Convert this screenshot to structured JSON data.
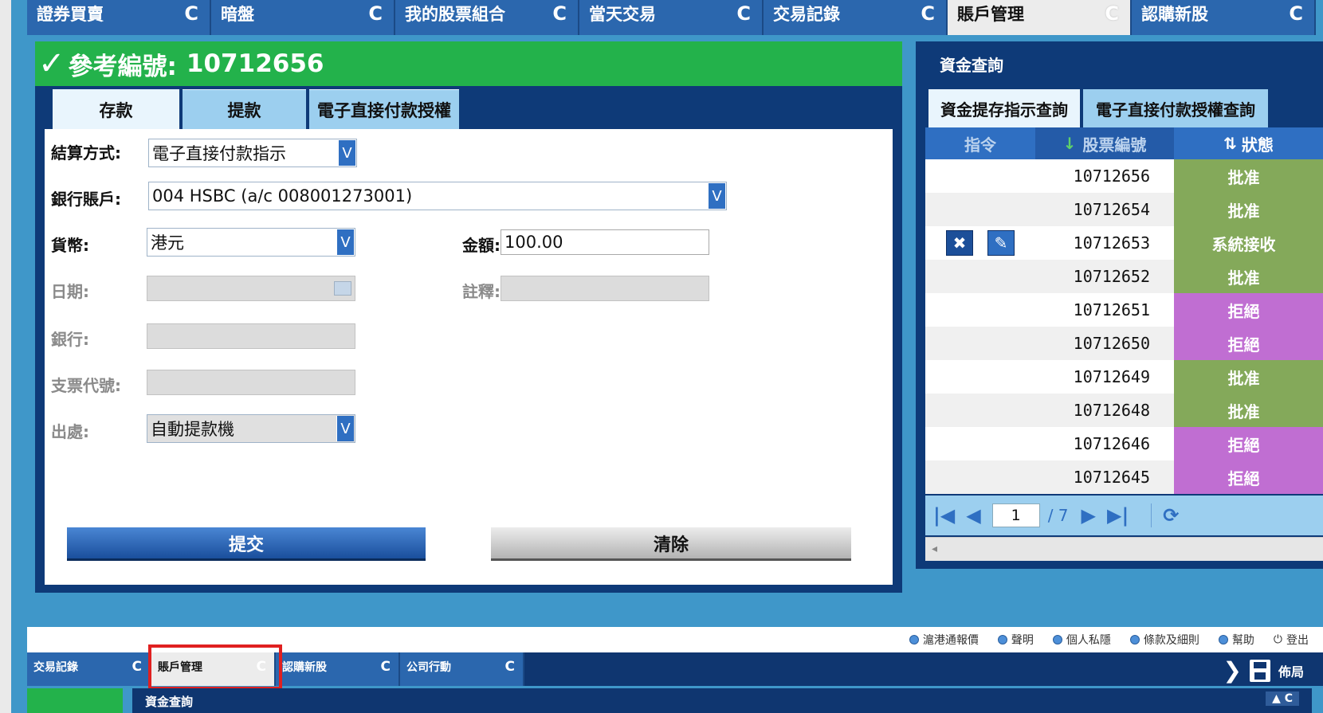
{
  "top_tabs": [
    {
      "label": "證券買賣",
      "active": false
    },
    {
      "label": "暗盤",
      "active": false
    },
    {
      "label": "我的股票組合",
      "active": false
    },
    {
      "label": "當天交易",
      "active": false
    },
    {
      "label": "交易記錄",
      "active": false
    },
    {
      "label": "賬戶管理",
      "active": true
    },
    {
      "label": "認購新股",
      "active": false
    }
  ],
  "refresh_glyph": "C",
  "left_panel": {
    "check_glyph": "✓",
    "ref_label": "參考編號:",
    "ref_number": "10712656",
    "tabs": [
      {
        "label": "存款",
        "active": true
      },
      {
        "label": "提款",
        "active": false
      },
      {
        "label": "電子直接付款授權",
        "active": false
      }
    ],
    "form": {
      "settlement_label": "結算方式:",
      "settlement_value": "電子直接付款指示",
      "bank_account_label": "銀行賬戶:",
      "bank_account_value": "004 HSBC (a/c 008001273001)",
      "currency_label": "貨幣:",
      "currency_value": "港元",
      "amount_label": "金額:",
      "amount_value": "100.00",
      "date_label": "日期:",
      "remark_label": "註釋:",
      "bank_label": "銀行:",
      "cheque_label": "支票代號:",
      "source_label": "出處:",
      "source_value": "自動提款機",
      "dropdown_glyph": "V"
    },
    "submit_label": "提交",
    "clear_label": "清除"
  },
  "right_panel": {
    "title": "資金查詢",
    "tabs": [
      {
        "label": "資金提存指示查詢",
        "active": true
      },
      {
        "label": "電子直接付款授權查詢",
        "active": false
      }
    ],
    "columns": {
      "action": "指令",
      "number": "股票編號",
      "status": "狀態"
    },
    "sort_glyph": "↓",
    "sort2_glyph": "⇅",
    "rows": [
      {
        "number": "10712656",
        "status": "批准",
        "color": "#84a95a",
        "actions": false
      },
      {
        "number": "10712654",
        "status": "批准",
        "color": "#84a95a",
        "actions": false
      },
      {
        "number": "10712653",
        "status": "系統接收",
        "color": "#84a95a",
        "actions": true
      },
      {
        "number": "10712652",
        "status": "批准",
        "color": "#84a95a",
        "actions": false
      },
      {
        "number": "10712651",
        "status": "拒絕",
        "color": "#c06ed2",
        "actions": false
      },
      {
        "number": "10712650",
        "status": "拒絕",
        "color": "#c06ed2",
        "actions": false
      },
      {
        "number": "10712649",
        "status": "批准",
        "color": "#84a95a",
        "actions": false
      },
      {
        "number": "10712648",
        "status": "批准",
        "color": "#84a95a",
        "actions": false
      },
      {
        "number": "10712646",
        "status": "拒絕",
        "color": "#c06ed2",
        "actions": false
      },
      {
        "number": "10712645",
        "status": "拒絕",
        "color": "#c06ed2",
        "actions": false
      }
    ],
    "action_cancel_glyph": "✖",
    "action_edit_glyph": "✎",
    "pager": {
      "page": "1",
      "total": "/ 7",
      "first_glyph": "|◀",
      "prev_glyph": "◀",
      "next_glyph": "▶",
      "last_glyph": "▶|",
      "refresh_glyph": "⟳"
    }
  },
  "bottom_links": [
    "滬港通報價",
    "聲明",
    "個人私隱",
    "條款及細則",
    "幫助"
  ],
  "logout_label": "登出",
  "logout_glyph": "⏻",
  "bottom_tabs": [
    {
      "label": "交易記錄",
      "active": false
    },
    {
      "label": "賬戶管理",
      "active": true
    },
    {
      "label": "認購新股",
      "active": false
    },
    {
      "label": "公司行動",
      "active": false
    }
  ],
  "layout_label": "佈局",
  "chevron_glyph": "❯",
  "bottom_panel_title": "資金查詢",
  "bottom_panel_ctrl": "▲ C",
  "colors": {
    "accent": "#2b67ae",
    "approved": "#84a95a",
    "rejected": "#c06ed2",
    "header_green": "#23b24b"
  }
}
